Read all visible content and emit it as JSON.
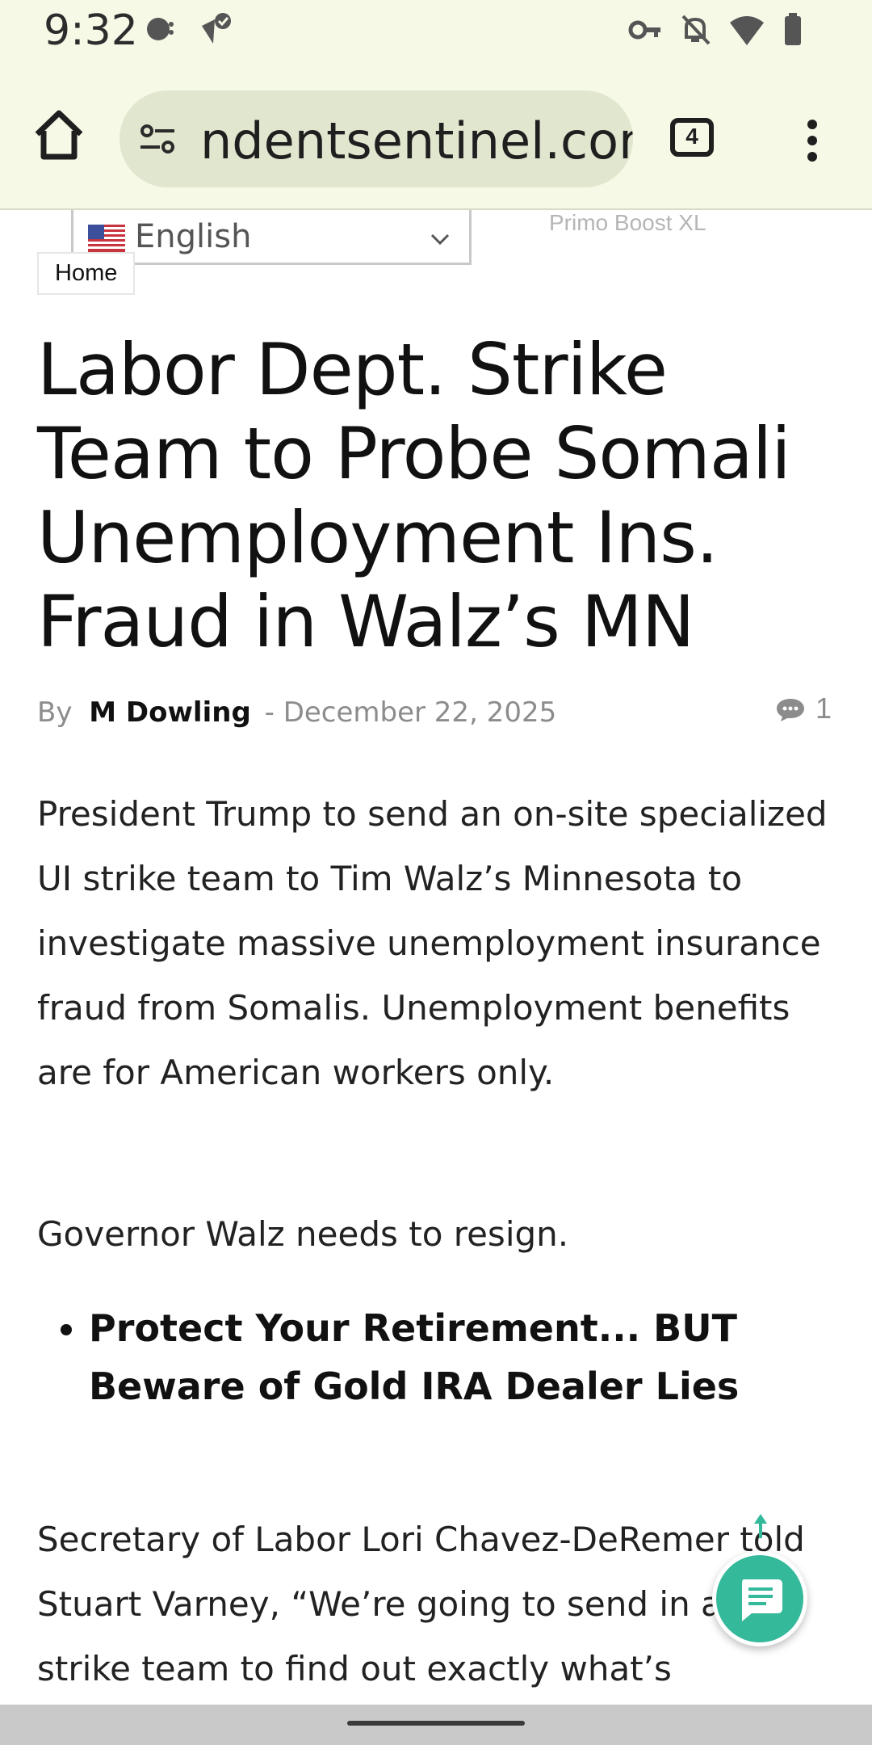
{
  "status_bar": {
    "time": "9:32"
  },
  "browser": {
    "url": "ndentsentinel.com",
    "tab_count": "4"
  },
  "page": {
    "top_link": "Primo Boost XL",
    "language": "English",
    "breadcrumb": "Home",
    "title": "Labor Dept. Strike Team to Probe Somali Unemployment Ins. Fraud in Walz’s MN",
    "byline": {
      "by": "By",
      "author": "M Dowling",
      "separator": "-",
      "date": "December 22, 2025"
    },
    "comment_count": "1",
    "paragraphs": [
      "President Trump to send an on-site specialized UI strike team to Tim Walz’s Minnesota to investigate massive unemployment insurance fraud from Somalis. Unemployment benefits are for American workers only.",
      "Governor Walz needs to resign.",
      "Secretary of Labor Lori Chavez-DeRemer told Stuart Varney, “We’re going to send in a UI strike team to find out exactly what’s happening on the ground. We will not tolerate fraud under this"
    ],
    "bullet_link": "Protect Your Retirement... BUT Beware of Gold IRA Dealer Lies"
  },
  "colors": {
    "chrome_background": "#f5f9e6",
    "url_pill": "#e1e6cf",
    "chat_fab": "#35b99b"
  },
  "icons": [
    "chat-bubble-icon",
    "wifi-icon",
    "battery-icon",
    "key-icon",
    "bell-off-icon",
    "home-icon",
    "site-info-icon",
    "more-vert-icon",
    "us-flag-icon",
    "chevron-down-icon",
    "comment-icon",
    "arrow-up-icon"
  ]
}
